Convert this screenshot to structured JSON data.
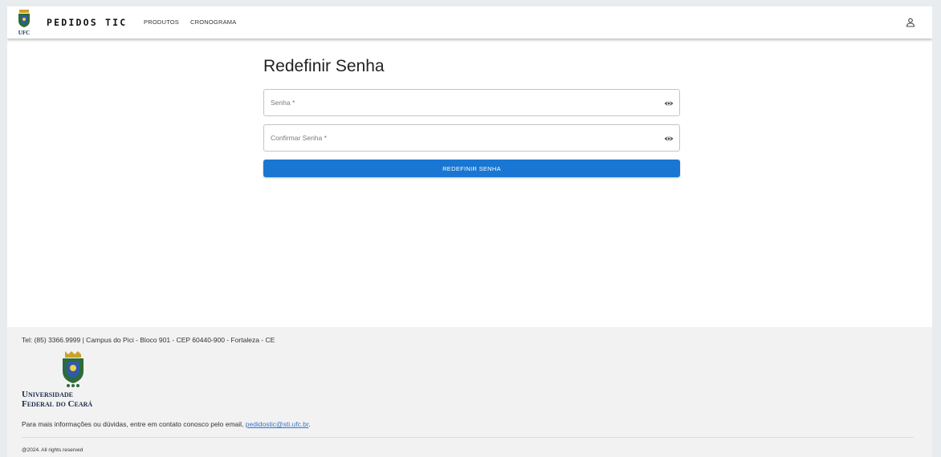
{
  "header": {
    "brand": "PEDIDOS TIC",
    "logo_caption": "UFC",
    "nav": [
      {
        "label": "PRODUTOS"
      },
      {
        "label": "CRONOGRAMA"
      }
    ],
    "user_icon": "user-icon"
  },
  "form": {
    "title": "Redefinir Senha",
    "password_label": "Senha *",
    "password_value": "",
    "confirm_label": "Confirmar Senha *",
    "confirm_value": "",
    "toggle_icon": "eye-icon",
    "submit_label": "REDEFINIR SENHA"
  },
  "footer": {
    "contact": "Tel: (85) 3366.9999 | Campus do Pici - Bloco 901 - CEP 60440-900 - Fortaleza - CE",
    "university_line1": "Universidade",
    "university_line2": "Federal do Ceará",
    "info_text": "Para mais informações ou dúvidas, entre em contato conosco pelo email, ",
    "email": "pedidostic@sti.ufc.br",
    "info_suffix": ".",
    "copyright": "@2024. All rights reserved"
  },
  "colors": {
    "primary": "#1976d2",
    "link": "#3b73c8",
    "footer_bg": "#f2f2f2"
  }
}
